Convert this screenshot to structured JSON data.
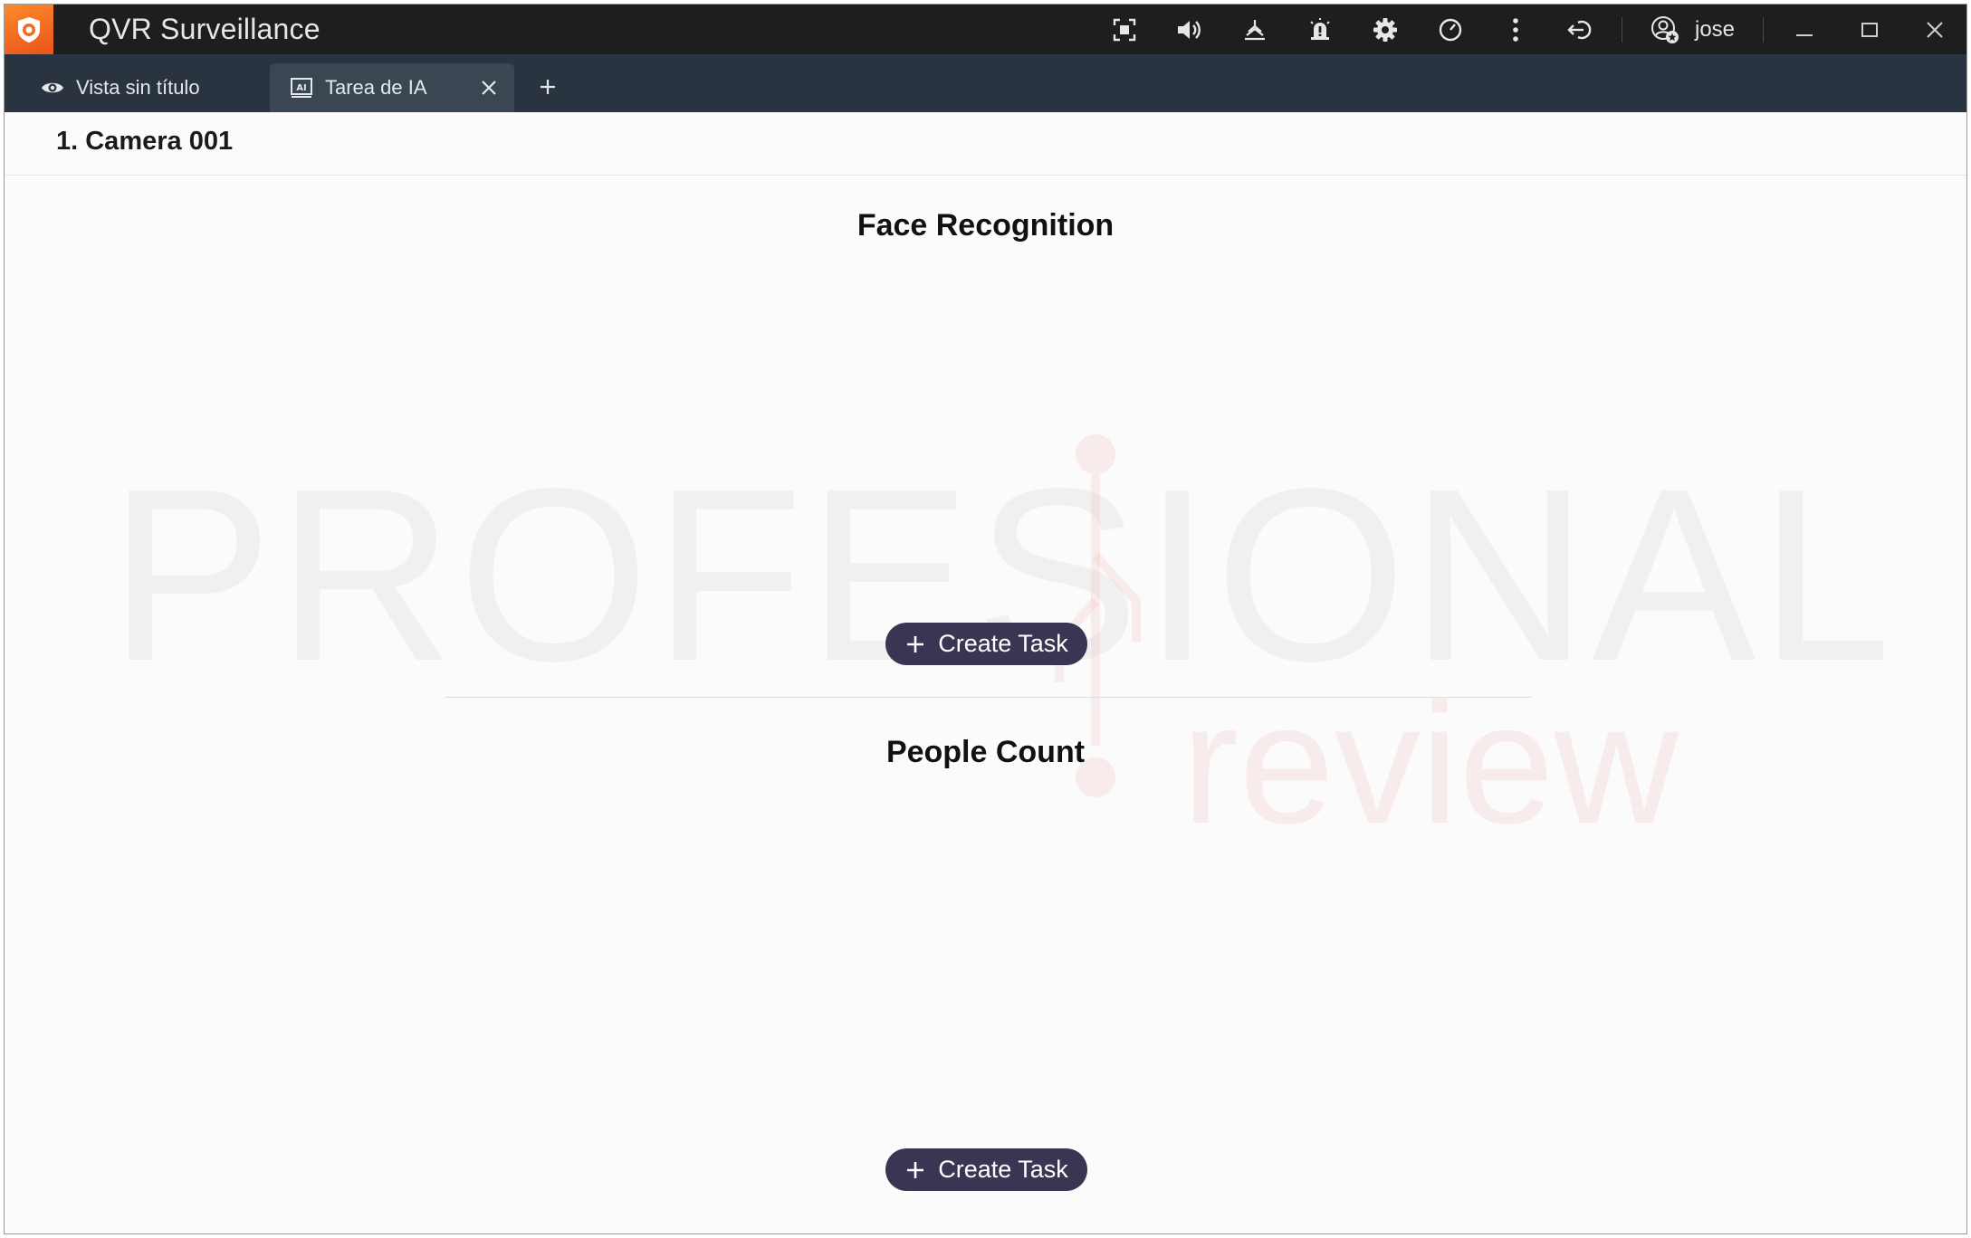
{
  "app": {
    "title": "QVR Surveillance",
    "user": "jose",
    "accent_color": "#f26a22",
    "titlebar_color": "#1e1e1e",
    "tabbar_color": "#2a3440"
  },
  "toolbar_icons": [
    "fullscreen-icon",
    "volume-icon",
    "layers-icon",
    "alarm-icon",
    "gear-icon",
    "speed-icon",
    "more-vertical-icon",
    "logout-icon",
    "user-icon"
  ],
  "window_controls": [
    "minimize-icon",
    "maximize-icon",
    "close-icon"
  ],
  "tabs": [
    {
      "label": "Vista sin título",
      "icon": "eye-icon",
      "active": false
    },
    {
      "label": "Tarea de IA",
      "icon": "ai-icon",
      "active": true
    }
  ],
  "camera": {
    "title": "1. Camera 001"
  },
  "sections": [
    {
      "title": "Face Recognition",
      "button_label": "Create Task"
    },
    {
      "title": "People Count",
      "button_label": "Create Task"
    }
  ],
  "watermark": {
    "line1": "PROFESIONAL",
    "line2": "review"
  },
  "button_color": "#3a3552"
}
